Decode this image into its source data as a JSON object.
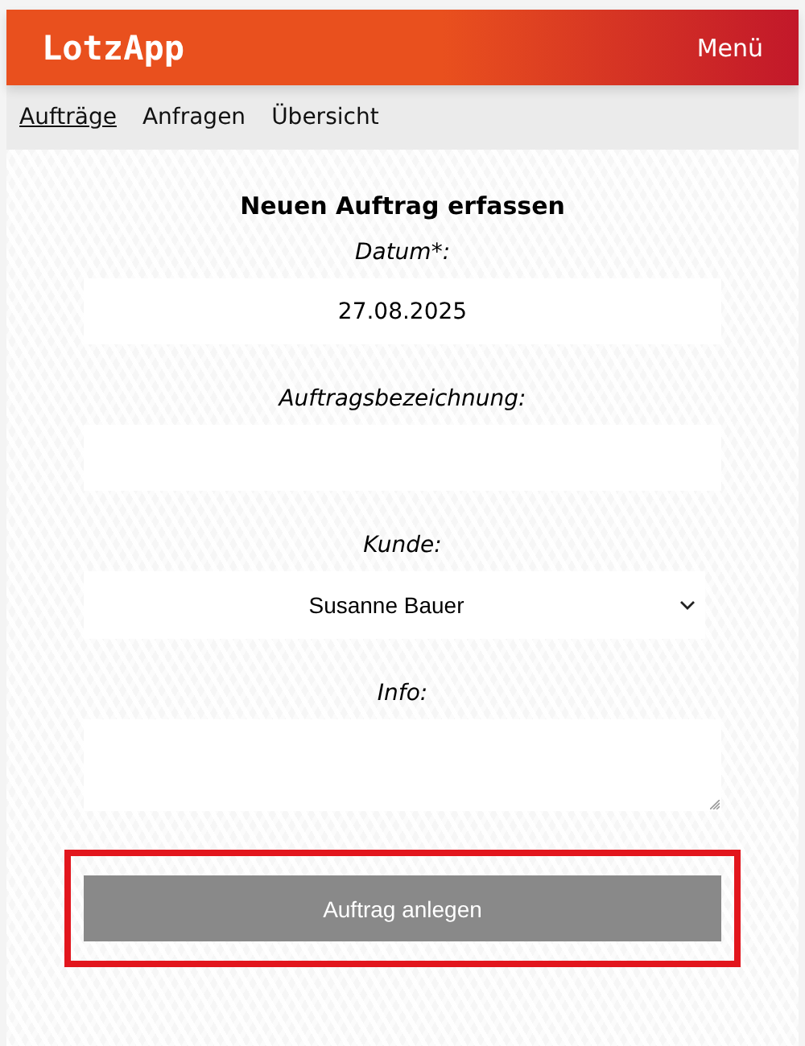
{
  "header": {
    "logo": "LotzApp",
    "menu": "Menü"
  },
  "nav": [
    {
      "label": "Aufträge",
      "selected": true
    },
    {
      "label": "Anfragen",
      "selected": false
    },
    {
      "label": "Übersicht",
      "selected": false
    }
  ],
  "form": {
    "title": "Neuen Auftrag erfassen",
    "fields": [
      {
        "kind": "text",
        "label": "Datum*:",
        "value": "27.08.2025"
      },
      {
        "kind": "text",
        "label": "Auftragsbezeichnung:"
      },
      {
        "kind": "select",
        "label": "Kunde:",
        "value": "Susanne Bauer"
      },
      {
        "kind": "textarea",
        "label": "Info:"
      }
    ],
    "submit": {
      "label": "Auftrag anlegen",
      "disabled": true,
      "highlighted": true
    }
  }
}
